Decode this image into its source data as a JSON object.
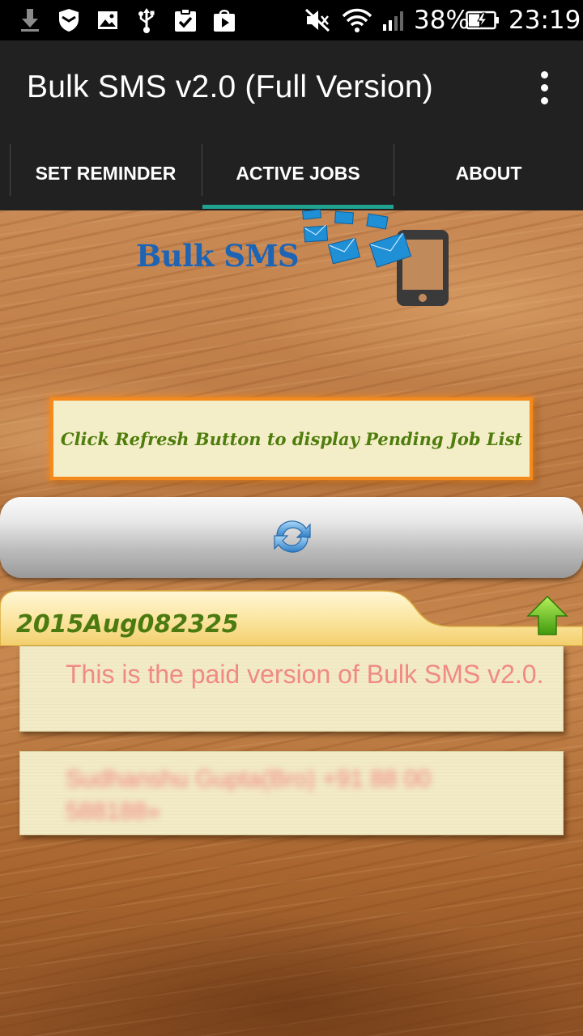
{
  "status_bar": {
    "battery_percent": "38%",
    "time": "23:19",
    "icons": [
      "download-icon",
      "shield-icon",
      "image-icon",
      "usb-icon",
      "clipboard-check-icon",
      "play-store-icon",
      "mute-icon",
      "wifi-icon",
      "signal-icon",
      "battery-icon"
    ]
  },
  "action_bar": {
    "title": "Bulk SMS v2.0 (Full Version)",
    "menu_icon": "overflow-menu-icon"
  },
  "tabs": [
    {
      "label": "SET REMINDER",
      "selected": false
    },
    {
      "label": "ACTIVE JOBS",
      "selected": true
    },
    {
      "label": "ABOUT",
      "selected": false
    }
  ],
  "accent_color": "#21a392",
  "logo": {
    "text": "Bulk SMS"
  },
  "info_box": {
    "text": "Click Refresh Button to display Pending Job List"
  },
  "refresh_button": {
    "icon": "refresh-icon"
  },
  "job": {
    "id": "2015Aug082325",
    "expand_icon": "up-arrow-icon",
    "message": "This is the paid version of Bulk SMS v2.0.",
    "recipients": "Sudhanshu Gupta(Bro) +91 88 00 588188»"
  }
}
